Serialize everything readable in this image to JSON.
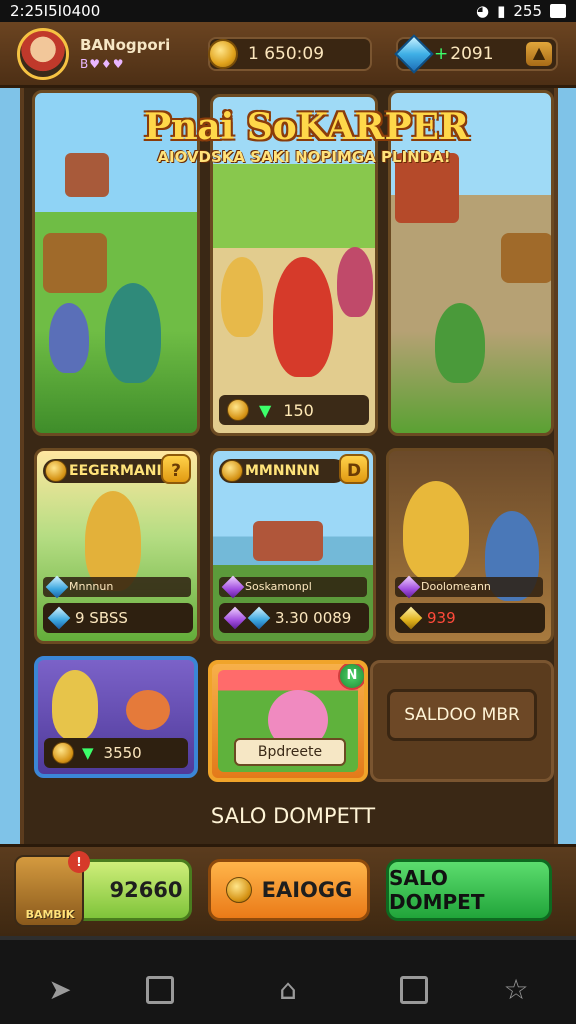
{
  "status_bar": {
    "time": "2:25I5I0400",
    "battery": "255"
  },
  "header": {
    "player_name": "BANogpori",
    "player_sub": "B♥♦♥",
    "coins": "1 650:09",
    "gems": "2091",
    "gem_plus": "+"
  },
  "title": {
    "main": "Pnai SoKARPER",
    "subtitle": "AIOVDSKA SAKI NOPIMGA PLINDA!"
  },
  "top_panels": {
    "reward_value": "150"
  },
  "cards": [
    {
      "title": "EEGERMANI",
      "badge": "?",
      "label": "Mnnnun",
      "price": "9  SBSS"
    },
    {
      "title": "MMNNNN",
      "badge": "D",
      "label": "Soskamonpl",
      "price": "3.30 0089"
    },
    {
      "title": "",
      "badge": "",
      "label": "Doolomeann",
      "price": "939"
    }
  ],
  "shop": {
    "s1_price": "3550",
    "s2_label": "Bpdreete",
    "s2_badge": "N",
    "saldo_button": "SALDOO MBR",
    "saldo_caption": "SALO DOMPETT"
  },
  "action_bar": {
    "chest_label": "BAMBIK",
    "chest_badge": "!",
    "btn1": "92660",
    "btn2": "EAIOGG",
    "btn3": "SALO DOMPET"
  },
  "colors": {
    "accent_gold": "#ffd84a",
    "wood_dark": "#3a2815",
    "button_green": "#21a53a",
    "button_orange": "#ea7a18"
  }
}
